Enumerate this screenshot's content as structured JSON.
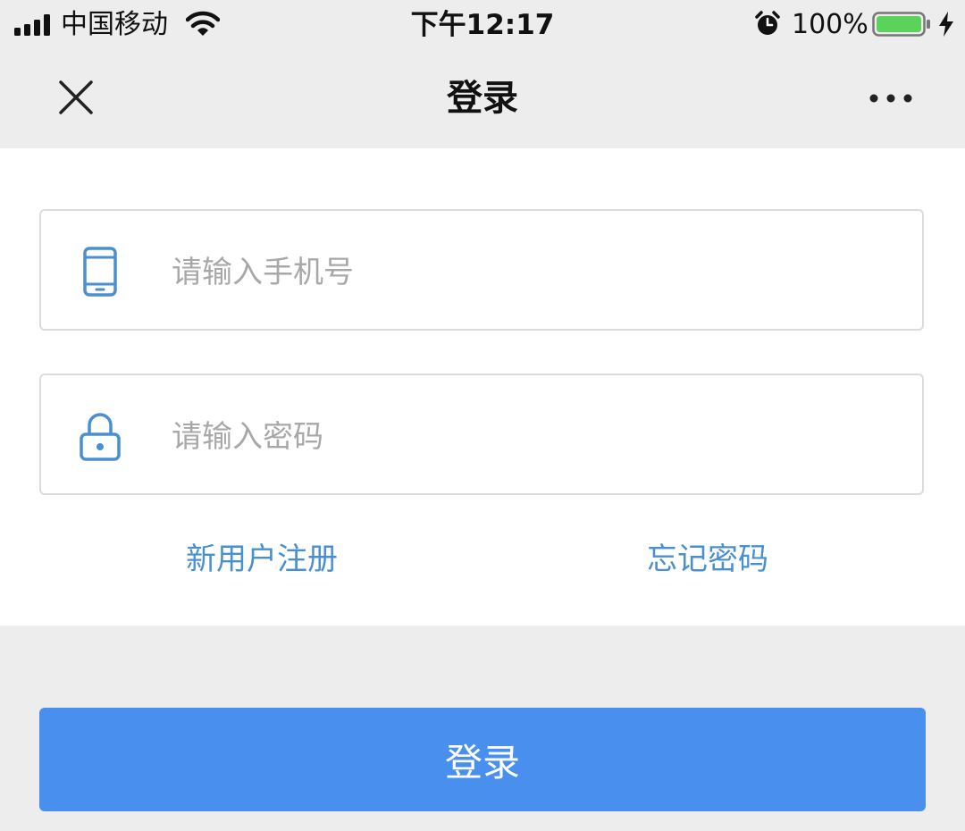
{
  "status_bar": {
    "carrier": "中国移动",
    "time": "下午12:17",
    "battery_percent": "100%",
    "battery_color": "#5bd35b"
  },
  "nav": {
    "title": "登录",
    "close_icon": "close-icon",
    "more_icon": "more-dots-icon"
  },
  "form": {
    "phone_placeholder": "请输入手机号",
    "password_placeholder": "请输入密码",
    "phone_icon": "phone-icon",
    "lock_icon": "lock-icon",
    "register_link": "新用户注册",
    "forgot_link": "忘记密码",
    "accent_color": "#4a8fd0"
  },
  "login_button": {
    "label": "登录",
    "color": "#4990ee"
  }
}
